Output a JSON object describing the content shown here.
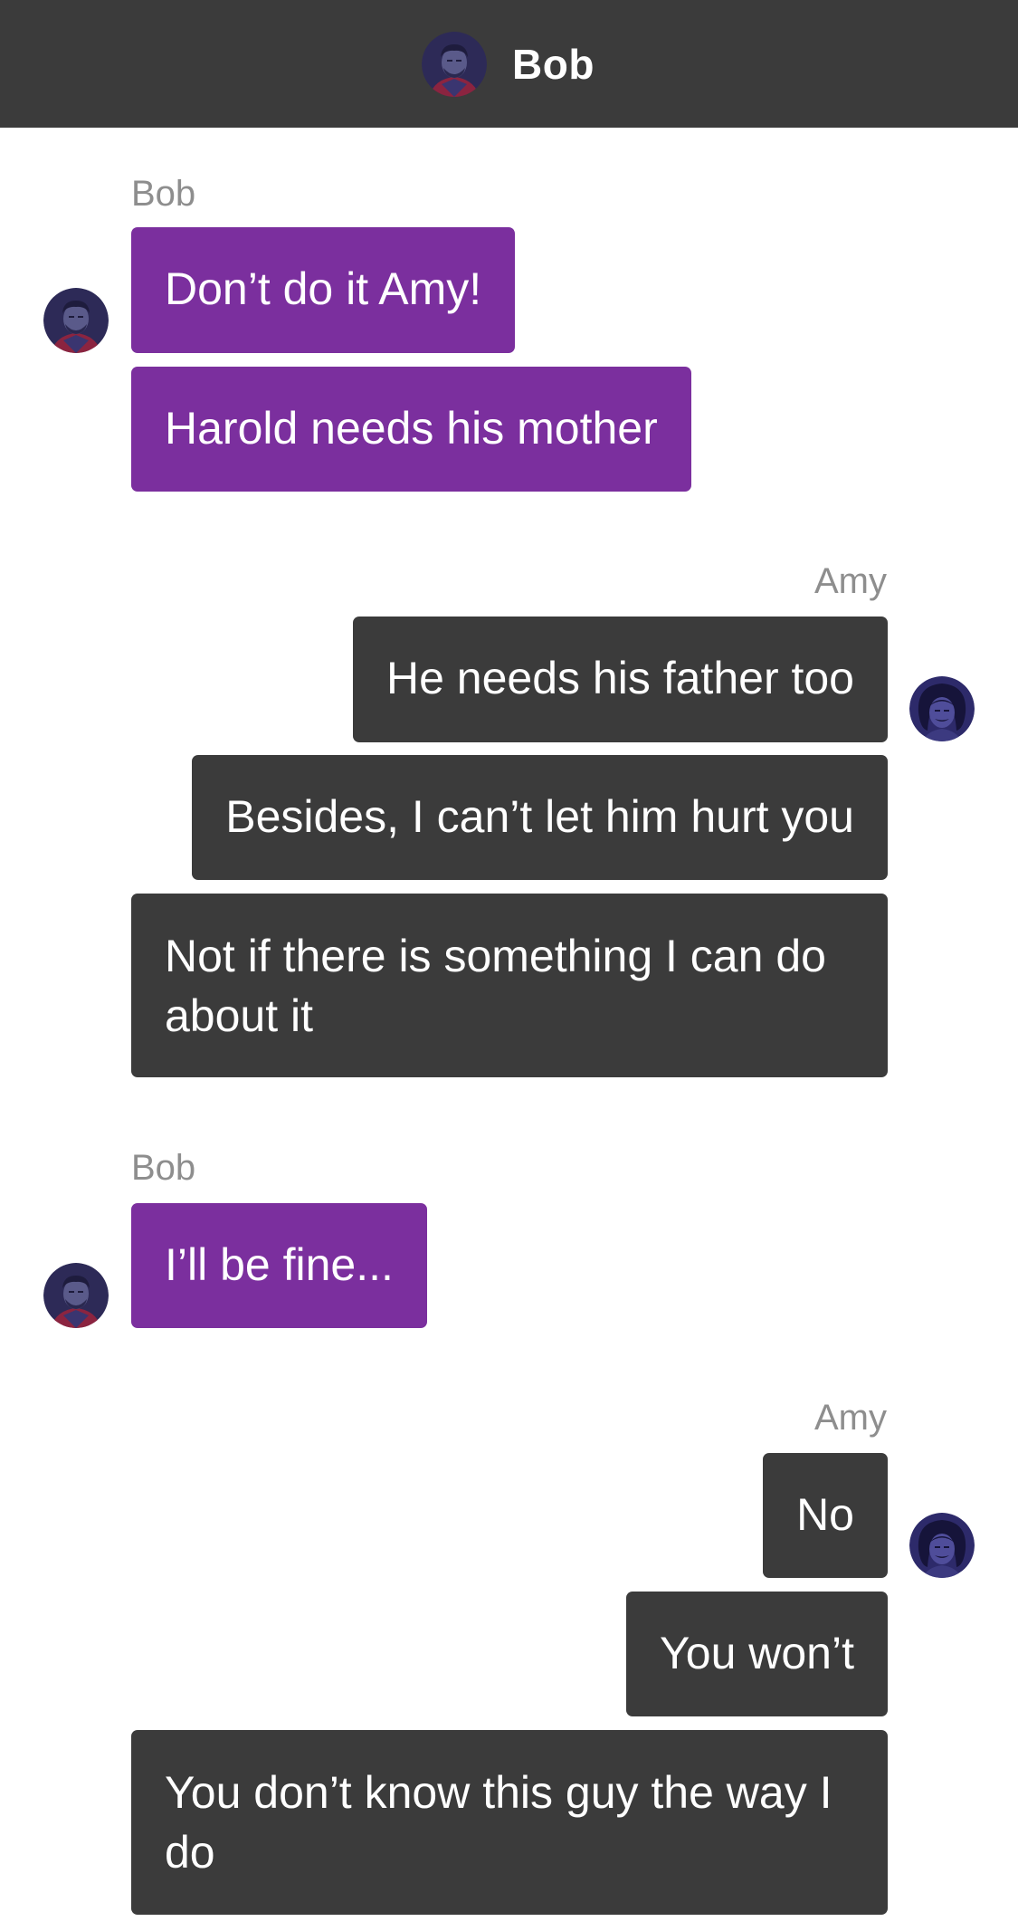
{
  "header": {
    "title": "Bob",
    "avatar_icon": "bob-avatar-icon"
  },
  "colors": {
    "header_bg": "#3b3b3b",
    "bob_bubble": "#7b2f9e",
    "amy_bubble": "#3b3b3b",
    "sender_label": "#8e8e8e"
  },
  "conversation": [
    {
      "sender": "Bob",
      "side": "left",
      "messages": [
        "Don’t do it Amy!",
        "Harold needs his mother"
      ]
    },
    {
      "sender": "Amy",
      "side": "right",
      "messages": [
        "He needs his father too",
        "Besides, I can’t let him hurt you",
        "Not if there is something I can do about it"
      ]
    },
    {
      "sender": "Bob",
      "side": "left",
      "messages": [
        "I’ll be fine..."
      ]
    },
    {
      "sender": "Amy",
      "side": "right",
      "messages": [
        "No",
        "You won’t",
        "You don’t know this guy the way I do"
      ]
    }
  ]
}
